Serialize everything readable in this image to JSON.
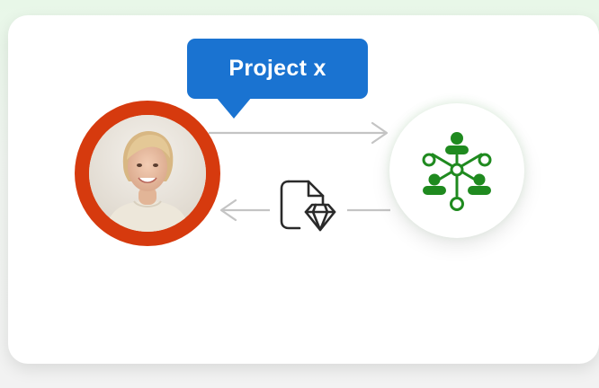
{
  "callout": {
    "label": "Project x"
  },
  "icons": {
    "avatar": "person-photo",
    "org_node": "org-hierarchy-icon",
    "file": "file-gem-icon",
    "arrow_right": "arrow-right-icon",
    "arrow_left": "arrow-left-icon"
  },
  "colors": {
    "callout_blue": "#1a73d1",
    "avatar_ring": "#d63a0e",
    "org_green": "#1f8a1f",
    "connector_gray": "#c4c4c4"
  }
}
